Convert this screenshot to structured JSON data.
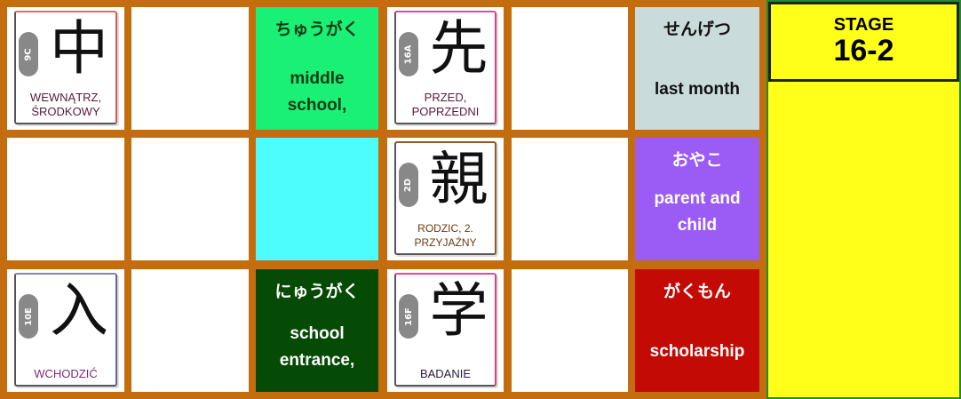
{
  "stage": {
    "label": "STAGE",
    "number": "16-2"
  },
  "kanji_cards": [
    {
      "kanji": "中",
      "code": "9C",
      "meaning_l1": "WEWNĄTRZ,",
      "meaning_l2": "ŚRODKOWY",
      "meaning_color": "#5a1a3a"
    },
    {
      "kanji": "先",
      "code": "16A",
      "meaning_l1": "PRZED,",
      "meaning_l2": "POPRZEDNI",
      "meaning_color": "#5a1a3a"
    },
    {
      "kanji": "親",
      "code": "2D",
      "meaning_l1": "RODZIC, 2.",
      "meaning_l2": "PRZYJAŹNY",
      "meaning_color": "#6a3a10"
    },
    {
      "kanji": "入",
      "code": "10E",
      "meaning_l1": "",
      "meaning_l2": "WCHODZIĆ",
      "meaning_color": "#7a2a7a"
    },
    {
      "kanji": "学",
      "code": "16F",
      "meaning_l1": "",
      "meaning_l2": "BADANIE",
      "meaning_color": "#2a1a3a"
    }
  ],
  "vocab_cards": [
    {
      "kana": "ちゅうがく",
      "eng_l1": "middle",
      "eng_l2": "school,",
      "bg": "#1aef76",
      "fg": "#123a12"
    },
    {
      "kana": "せんげつ",
      "eng_l1": "last month",
      "eng_l2": "",
      "bg": "#c9dbdb",
      "fg": "#111111"
    },
    {
      "kana": "おやこ",
      "eng_l1": "parent and",
      "eng_l2": "child",
      "bg": "#9a5cf5",
      "fg": "#ffffff"
    },
    {
      "kana": "にゅうがく",
      "eng_l1": "school",
      "eng_l2": "entrance,",
      "bg": "#054a05",
      "fg": "#ffffff"
    },
    {
      "kana": "がくもん",
      "eng_l1": "scholarship",
      "eng_l2": "",
      "bg": "#c30a05",
      "fg": "#ffffff"
    }
  ],
  "colors": {
    "frame": "#c46d0f",
    "empty_cyan": "#4dfdfd",
    "stage_bg": "#ffff19"
  }
}
